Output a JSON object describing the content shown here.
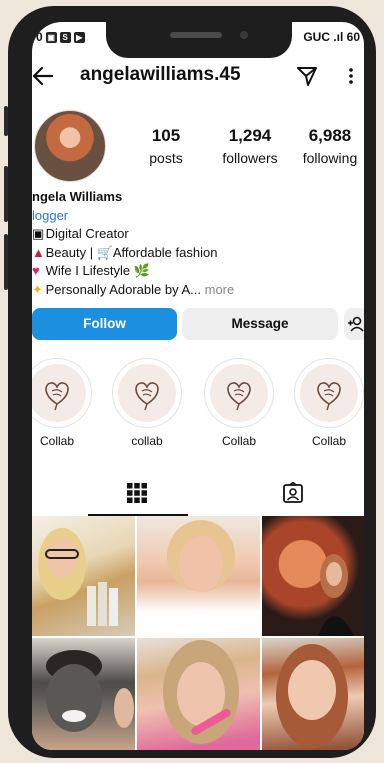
{
  "status": {
    "right_text": "GUC .ıl 60"
  },
  "topbar": {
    "username": "angelawilliams.45"
  },
  "profile": {
    "stats": [
      {
        "value": "105",
        "label": "posts"
      },
      {
        "value": "1,294",
        "label": "followers"
      },
      {
        "value": "6,988",
        "label": "following"
      }
    ],
    "name": "ngela Williams",
    "category": "logger",
    "bio_lines": [
      "Digital Creator",
      "Beauty | 🛒Affordable fashion",
      "Wife I Lifestyle 🌿",
      "Personally Adorable by A...",
      "more"
    ]
  },
  "actions": {
    "follow": "Follow",
    "message": "Message"
  },
  "highlights": [
    {
      "label": "Collab"
    },
    {
      "label": "collab"
    },
    {
      "label": "Collab"
    },
    {
      "label": "Collab"
    }
  ],
  "icons": {
    "back": "back-arrow-icon",
    "send": "direct-message-icon",
    "more": "more-vertical-icon",
    "add_user": "add-user-icon",
    "grid": "grid-icon",
    "tagged": "tagged-icon"
  }
}
